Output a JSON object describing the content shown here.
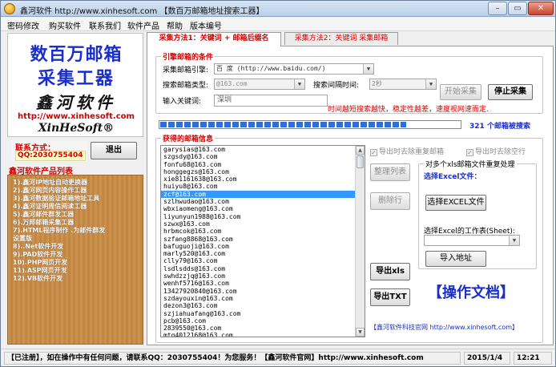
{
  "window": {
    "title": "鑫河软件 http://www.xinhesoft.com 【数百万邮箱地址搜索工器】",
    "min": "–",
    "max": "▭",
    "close": "✕"
  },
  "menu": [
    "密码修改",
    "购买软件",
    "联系我们",
    "软件产品",
    "帮助",
    "版本编号"
  ],
  "logo": {
    "line1": "数百万邮箱",
    "line2": "采集工器",
    "line3": "鑫河软件",
    "url": "http://www.xinhesoft.com",
    "brand": "XinHeSoft®"
  },
  "contact": {
    "label": "联系方式：",
    "qq": "QQ:2030755404"
  },
  "exit_button": "退出",
  "products": {
    "title": "鑫河软件产品列表",
    "items": [
      "1).鑫河IP地址自动更换器",
      "2).鑫河网页内容操作工器",
      "3).鑫河数据验证邮箱地址工具",
      "4).鑫河证明周信阅读工器",
      "5).鑫河邮件群发工器",
      "6).万邦邮箱采集工器",
      "7).HTML程序制作 .为邮件群发",
      "设置版",
      "8)..Net软件开发",
      "9).PAD软件开发",
      "10).PHP网页开发",
      "11).ASP网页开发",
      "12).VB软件开发"
    ]
  },
  "tabs": [
    {
      "label": "采集方法1：关键词 + 邮箱后缀名",
      "active": true
    },
    {
      "label": "采集方法2：关键词 采集邮箱",
      "active": false
    }
  ],
  "conditions": {
    "title": "引擎邮箱的条件",
    "engine_label": "采集邮箱引擎:",
    "engine_value": "百 度 (http://www.baidu.com/)",
    "type_label": "搜索邮箱类型:",
    "type_value": "@163.com",
    "interval_label": "搜索间隔时间:",
    "interval_value": "2秒",
    "keyword_label": "输入关键词:",
    "keyword_value": "深圳",
    "start_button": "开始采集",
    "stop_button": "停止采集",
    "hint": "时间越短搜索越快，稳定性越差，速度视网速而定."
  },
  "progress": {
    "fraction": 0.82,
    "count": "321",
    "count_suffix": "个邮箱被搜索"
  },
  "results": {
    "title": "获得的邮箱信息",
    "emails": [
      "garysias@163.com",
      "szgsdy@163.com",
      "fonfu68@163.com",
      "honggegzs@163.com",
      "xie81161638@163.com",
      "huiyu8@163.com",
      "zcf@163.com",
      "szlhwudao@163.com",
      "wbxiaomeng@163.com",
      "liyunyun1988@163.com",
      "szwx@163.com",
      "hrbmcok@163.com",
      "szfang8868@163.com",
      "bafuguoji@163.com",
      "marly520@163.com",
      "clly79@163.com",
      "lsdlsdds@163.com",
      "swhdzzjq@163.com",
      "wenhf5716@163.com",
      "13427920840@163.com",
      "szdayouxin@163.com",
      "dezon3@163.com",
      "szjiahuafang@163.com",
      "pcb@163.com",
      "2839550@163.com",
      "mtq4012168@163.com"
    ],
    "selected_index": 6,
    "chk_dedupe": "导出时去除重复邮箱",
    "chk_blank": "导出时去除空行",
    "btn_tidy": "整理列表",
    "btn_delete": "删除行",
    "btn_export_xls": "导出xls",
    "btn_export_txt": "导出TXT"
  },
  "excel": {
    "title": "对多个xls邮箱文件重复处理",
    "file_label": "选择Excel文件：",
    "select_button": "选择EXCEL文件",
    "sheet_label": "选择Excel的工作表(Sheet):",
    "sheet_value": "",
    "import_button": "导入地址"
  },
  "doc_title": "【操作文档】",
  "site_link": "【鑫河软件科技官网 http://www.xinhesoft.com】",
  "status": {
    "message": "【已注册】，如在操作中有任何问题，请联系QQ：2030755404！为您服务！【鑫河软件官网】http://www.xinhesoft.com",
    "date": "2015/1/4",
    "time": "12:21"
  }
}
